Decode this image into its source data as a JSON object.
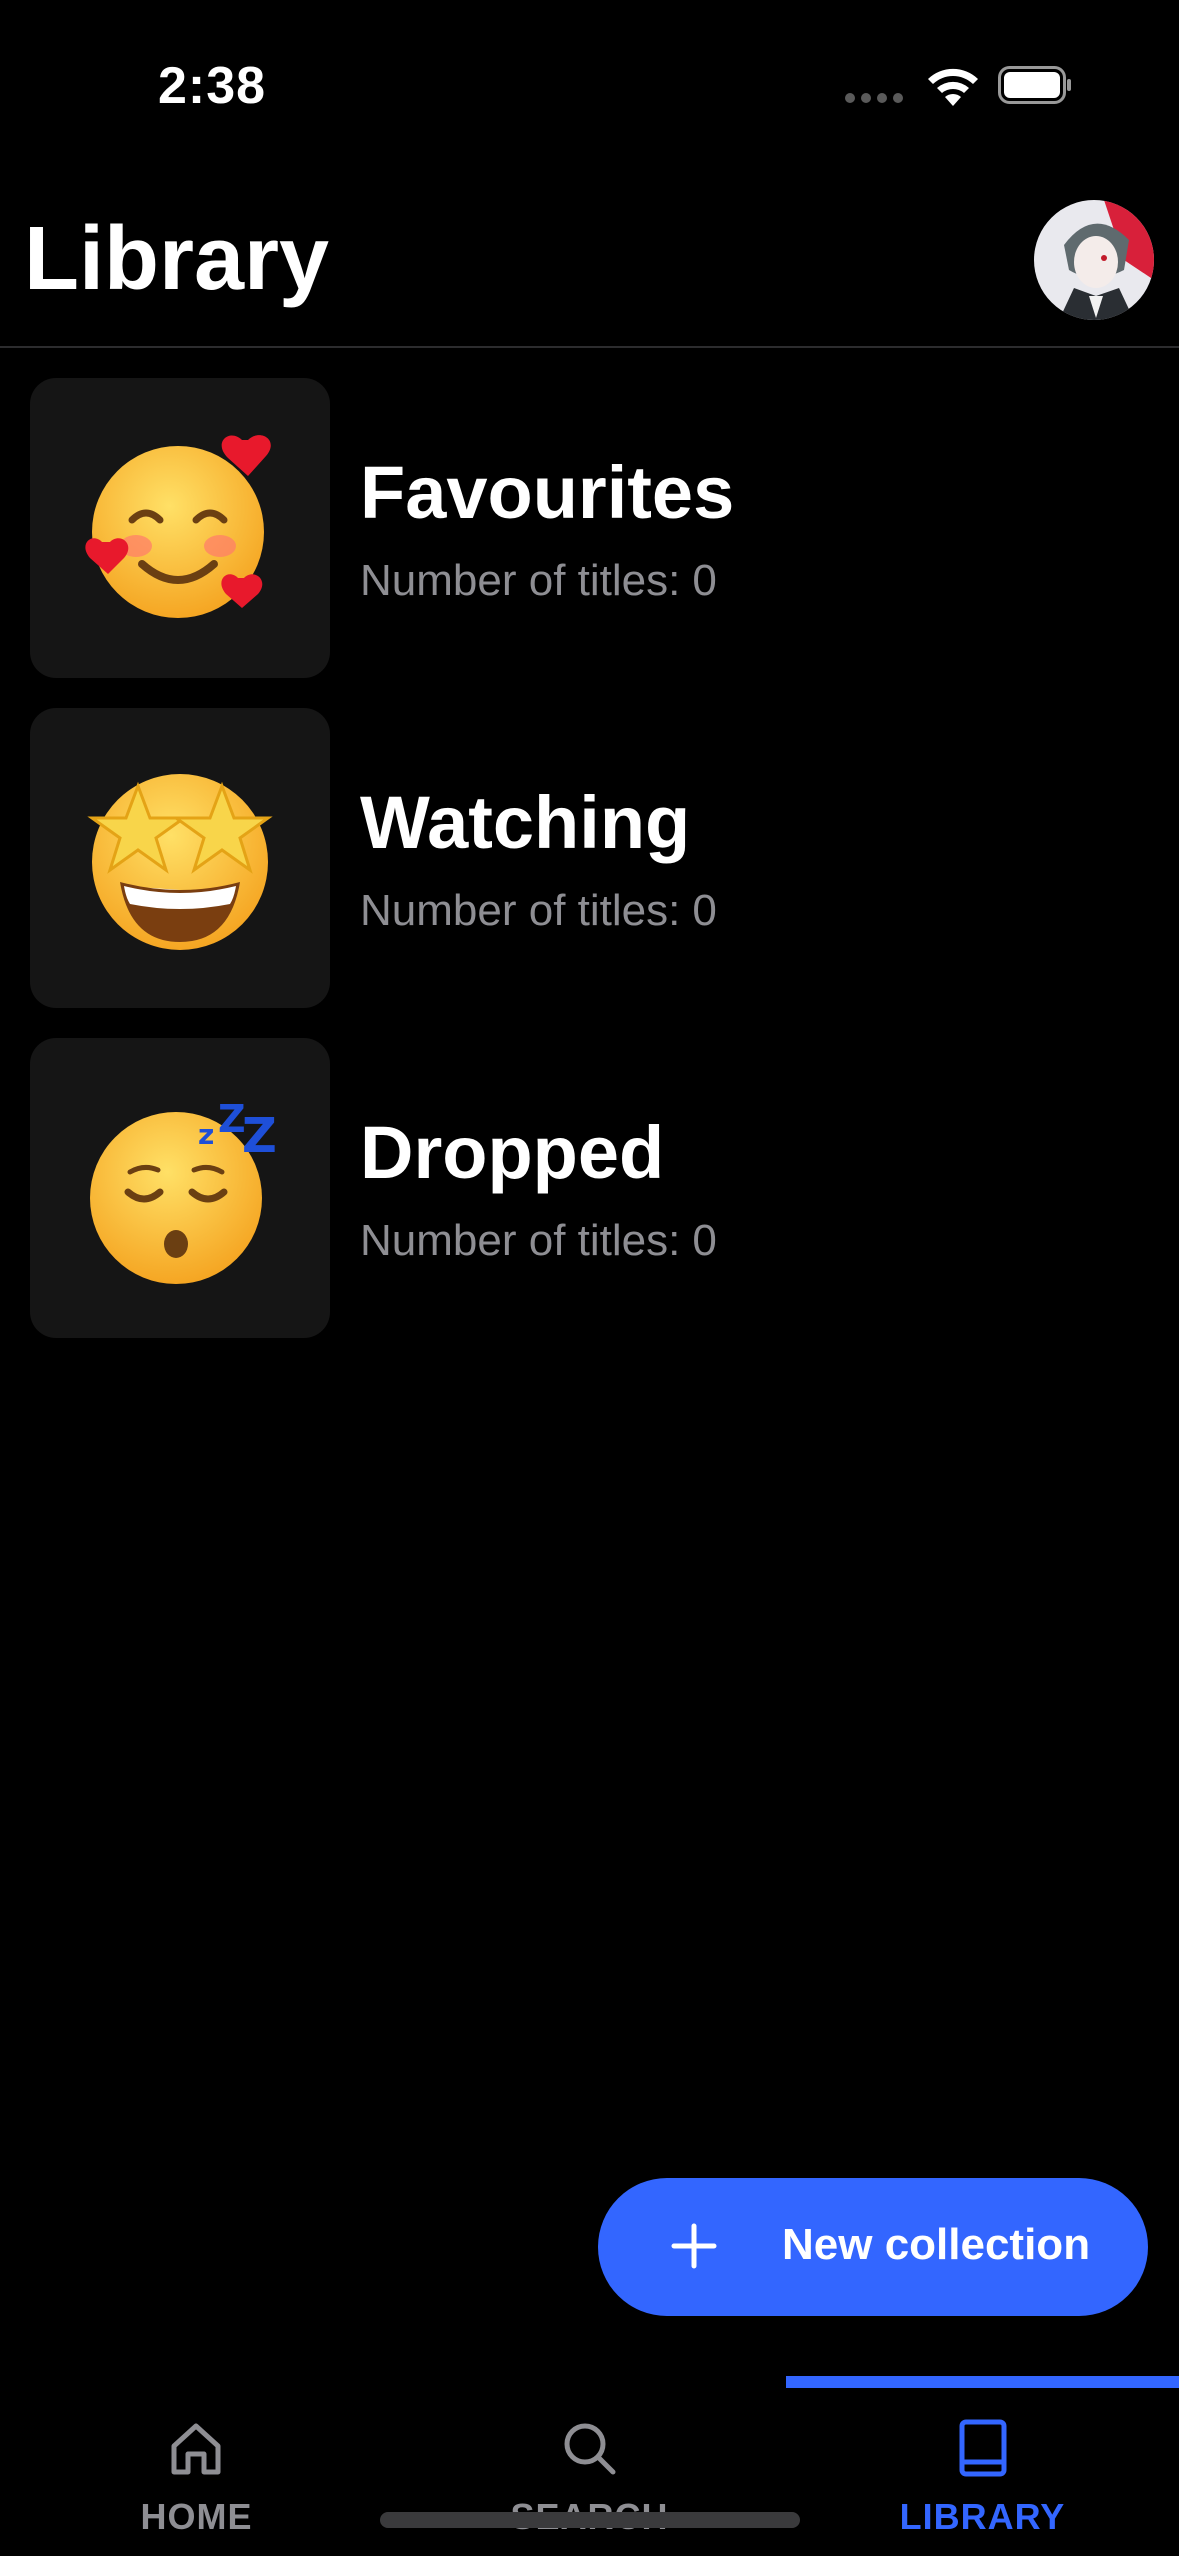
{
  "status_bar": {
    "time": "2:38"
  },
  "header": {
    "title": "Library"
  },
  "collections": [
    {
      "title": "Favourites",
      "count_label": "Number of titles:",
      "count": "0",
      "icon": "smiling-face-with-hearts-icon"
    },
    {
      "title": "Watching",
      "count_label": "Number of titles:",
      "count": "0",
      "icon": "star-struck-icon"
    },
    {
      "title": "Dropped",
      "count_label": "Number of titles:",
      "count": "0",
      "icon": "sleeping-face-icon"
    }
  ],
  "fab": {
    "label": "New collection",
    "icon": "plus-icon"
  },
  "tabs": [
    {
      "label": "HOME",
      "icon": "home-icon",
      "active": false
    },
    {
      "label": "SEARCH",
      "icon": "search-icon",
      "active": false
    },
    {
      "label": "LIBRARY",
      "icon": "book-icon",
      "active": true
    }
  ],
  "colors": {
    "accent": "#3366ff",
    "inactive_tab": "#8e8e93",
    "subtitle": "#8e8e93",
    "card_bg": "#151515",
    "background": "#000000"
  }
}
